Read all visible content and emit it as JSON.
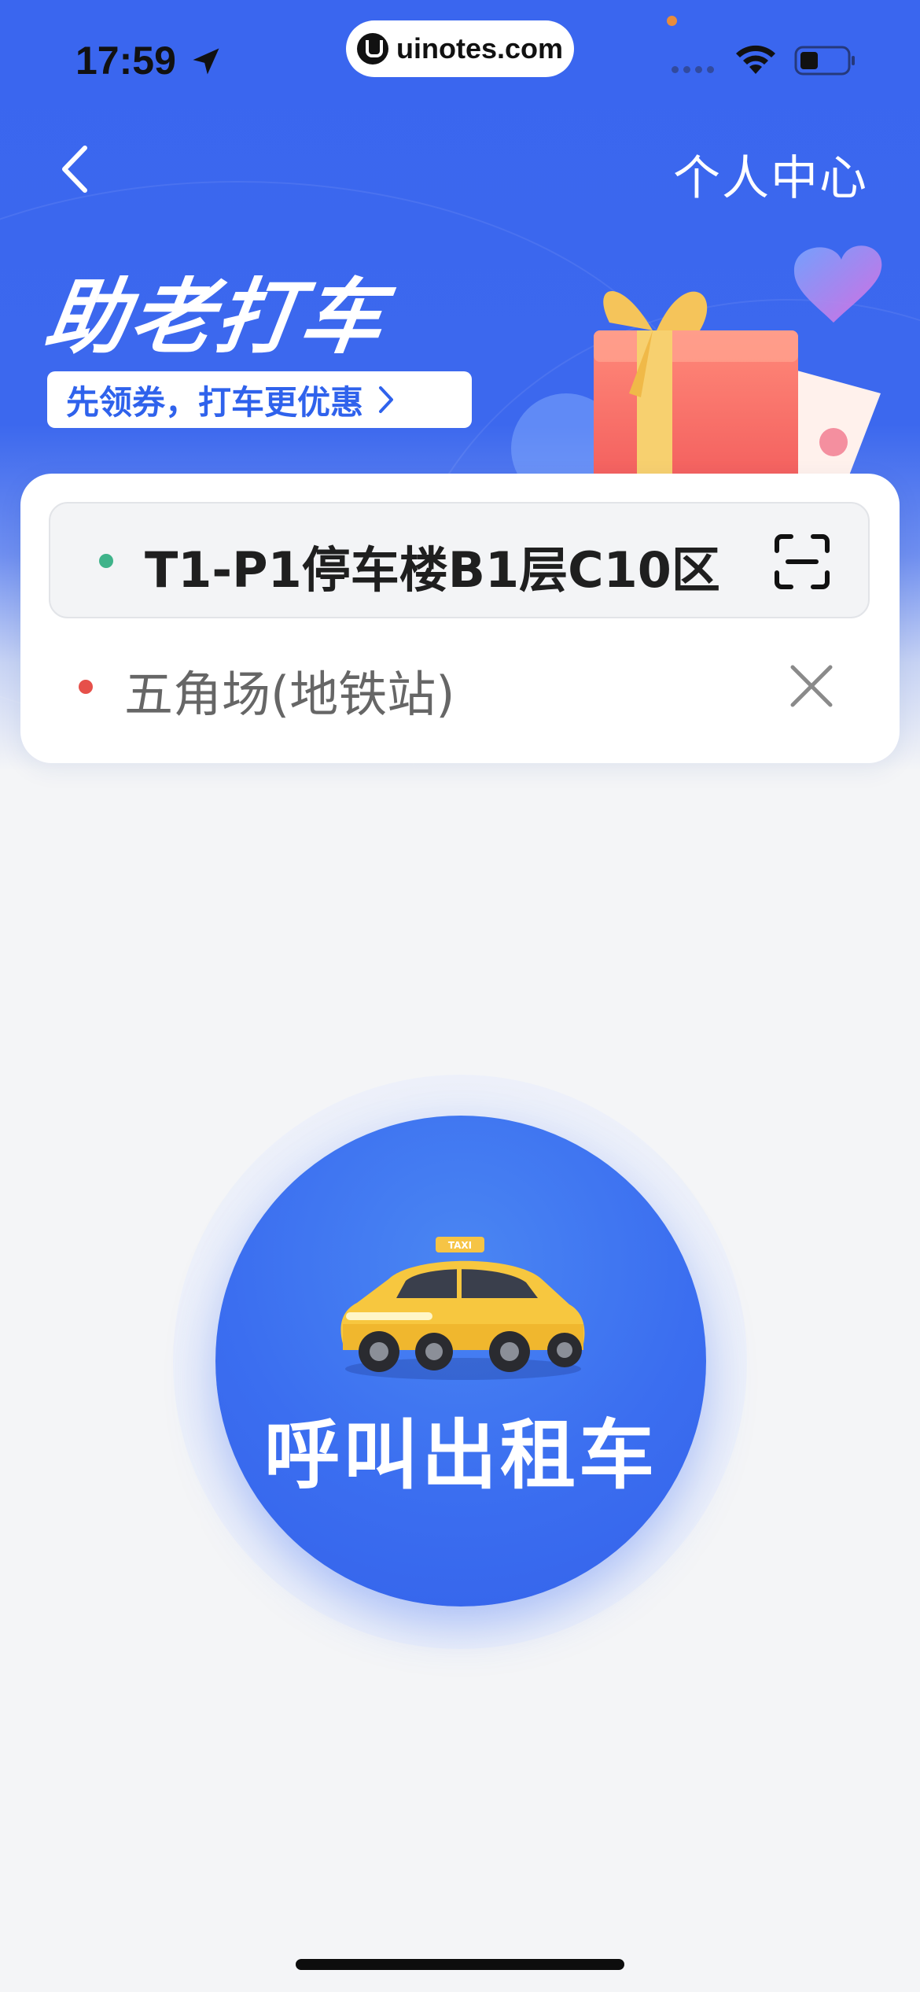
{
  "status_bar": {
    "time": "17:59",
    "watermark": "uinotes.com"
  },
  "nav": {
    "back_icon": "chevron-left-icon",
    "right_link": "个人中心"
  },
  "hero": {
    "title": "助老打车",
    "promo": "先领券，打车更优惠"
  },
  "route": {
    "pickup": "T1-P1停车楼B1层C10区",
    "destination": "五角场(地铁站)",
    "pickup_dot_color": "#3fb38a",
    "destination_dot_color": "#e6504a"
  },
  "call_button": {
    "label": "呼叫出租车",
    "taxi_sign": "TAXI"
  },
  "colors": {
    "brand_blue": "#3a66ef",
    "background": "#f4f5f7"
  }
}
